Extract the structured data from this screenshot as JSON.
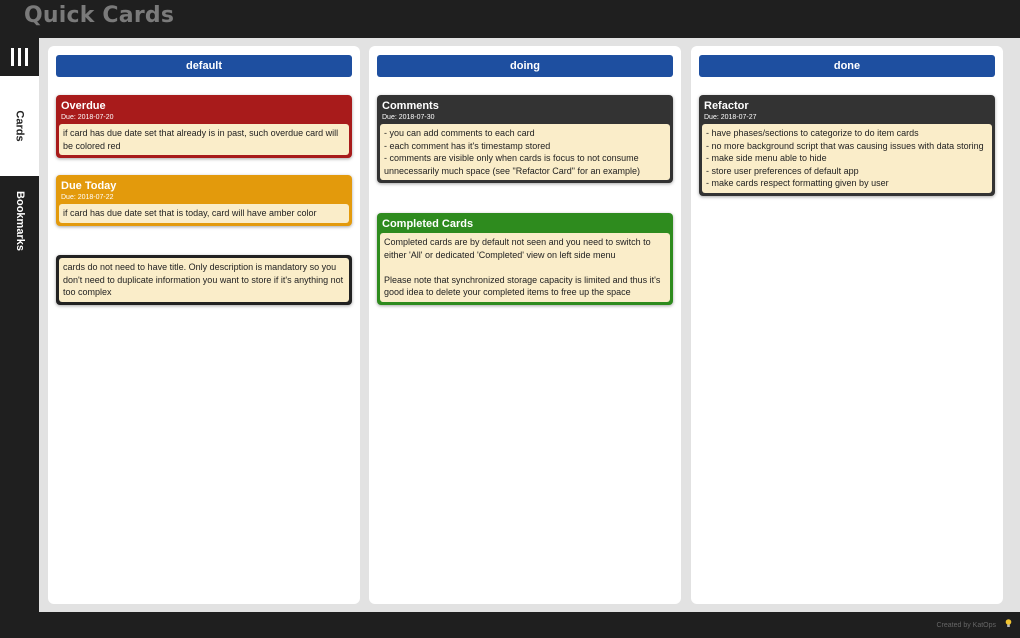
{
  "app": {
    "title": "Quick Cards"
  },
  "sidebar": {
    "tabs": [
      {
        "label": "Cards"
      },
      {
        "label": "Bookmarks"
      }
    ]
  },
  "columns": [
    {
      "title": "default",
      "cards": [
        {
          "title": "Overdue",
          "due": "Due: 2018-07-20",
          "color": "#a81b1b",
          "body": "if card has due date set that already is in past, such overdue card will be colored red"
        },
        {
          "title": "Due Today",
          "due": "Due: 2018-07-22",
          "color": "#e39a0c",
          "body": "if card has due date set that is today, card will have amber color"
        },
        {
          "title": "",
          "due": "",
          "color": "#222222",
          "body": "cards do not need to have title. Only description is mandatory so you don't need to duplicate information you want to store if it's anything not too complex"
        }
      ]
    },
    {
      "title": "doing",
      "cards": [
        {
          "title": "Comments",
          "due": "Due: 2018-07-30",
          "color": "#333333",
          "body": "- you can add comments to each card\n- each comment has it's timestamp stored\n- comments are visible only when cards is focus to not consume unnecessarily much space (see \"Refactor Card\" for an example)"
        },
        {
          "title": "Completed Cards",
          "due": "",
          "color": "#2e8b1e",
          "body": "Completed cards are by default not seen and you need to switch to either 'All' or dedicated 'Completed' view on left side menu\n\nPlease note that synchronized storage capacity is limited and thus it's good idea to delete your completed items to free up the space"
        }
      ]
    },
    {
      "title": "done",
      "cards": [
        {
          "title": "Refactor",
          "due": "Due: 2018-07-27",
          "color": "#333333",
          "body": "- have phases/sections to categorize to do item cards\n- no more background script that was causing issues with data storing\n- make side menu able to hide\n- store user preferences of default app\n- make cards respect formatting given by user"
        }
      ]
    }
  ],
  "footer": {
    "credit": "Created by KatOps",
    "icon": "lightbulb-icon"
  },
  "colors": {
    "header_blue": "#1e4fa0",
    "card_body": "#faedc9"
  }
}
